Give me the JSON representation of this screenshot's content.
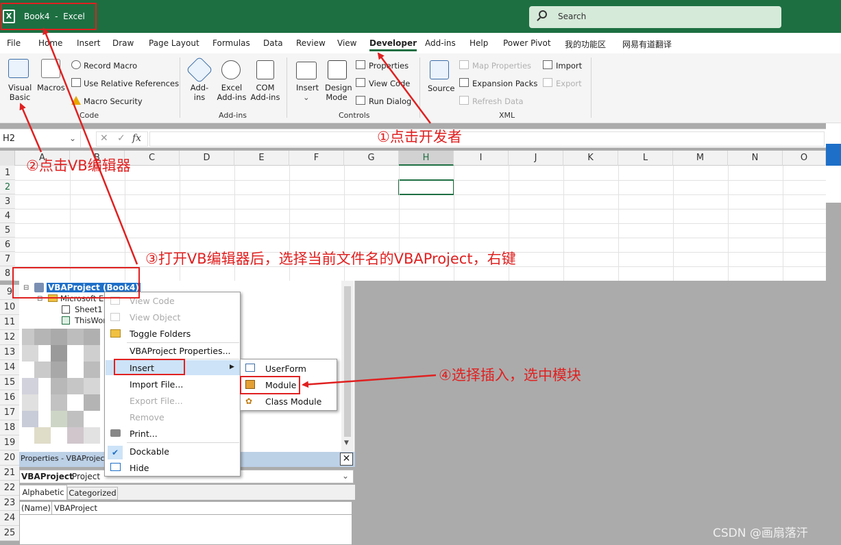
{
  "window": {
    "title": "Book4  -  Excel",
    "search_placeholder": "Search"
  },
  "menu": [
    "File",
    "Home",
    "Insert",
    "Draw",
    "Page Layout",
    "Formulas",
    "Data",
    "Review",
    "View",
    "Developer",
    "Add-ins",
    "Help",
    "Power Pivot",
    "我的功能区",
    "网易有道翻译"
  ],
  "ribbon": {
    "code": {
      "visual_basic": "Visual Basic",
      "macros": "Macros",
      "record_macro": "Record Macro",
      "use_relative": "Use Relative References",
      "macro_security": "Macro Security",
      "label": "Code"
    },
    "addins": {
      "addins": "Add-ins",
      "excel_addins": "Excel Add-ins",
      "com_addins": "COM Add-ins",
      "label": "Add-ins"
    },
    "controls": {
      "insert": "Insert",
      "design_mode": "Design Mode",
      "properties": "Properties",
      "view_code": "View Code",
      "run_dialog": "Run Dialog",
      "label": "Controls"
    },
    "xml": {
      "source": "Source",
      "map_properties": "Map Properties",
      "expansion_packs": "Expansion Packs",
      "refresh_data": "Refresh Data",
      "import": "Import",
      "export": "Export",
      "label": "XML"
    }
  },
  "formula_bar": {
    "name_box": "H2",
    "fx": "fx"
  },
  "columns": [
    "A",
    "B",
    "C",
    "D",
    "E",
    "F",
    "G",
    "H",
    "I",
    "J",
    "K",
    "L",
    "M",
    "N",
    "O"
  ],
  "rows": [
    "1",
    "2",
    "3",
    "4",
    "5",
    "6",
    "7",
    "8",
    "9",
    "10",
    "11",
    "12",
    "13",
    "14",
    "15",
    "16",
    "17",
    "18",
    "19",
    "20",
    "21",
    "22",
    "23",
    "24",
    "25"
  ],
  "project_tree": {
    "root": "VBAProject (Book4)",
    "folder": "Microsoft E",
    "sheet1": "Sheet1",
    "thisworkbook": "ThisWor"
  },
  "properties": {
    "title": "Properties - VBAProject",
    "object_name": "VBAProject",
    "object_type": "Project",
    "tab_alpha": "Alphabetic",
    "tab_cat": "Categorized",
    "name_key": "(Name)",
    "name_value": "VBAProject"
  },
  "context_menu": {
    "view_code": "View Code",
    "view_object": "View Object",
    "toggle_folders": "Toggle Folders",
    "project_properties": "VBAProject Properties...",
    "insert": "Insert",
    "import_file": "Import File...",
    "export_file": "Export File...",
    "remove": "Remove",
    "print": "Print...",
    "dockable": "Dockable",
    "hide": "Hide"
  },
  "submenu": {
    "userform": "UserForm",
    "module": "Module",
    "class_module": "Class Module"
  },
  "annotations": {
    "a1": "①点击开发者",
    "a2": "②点击VB编辑器",
    "a3": "③打开VB编辑器后，选择当前文件名的VBAProject，右键",
    "a4": "④选择插入，选中模块"
  },
  "watermark": "CSDN @画扇落汗",
  "colors": {
    "excel_green": "#1d6f42",
    "annotation_red": "#e02020"
  }
}
